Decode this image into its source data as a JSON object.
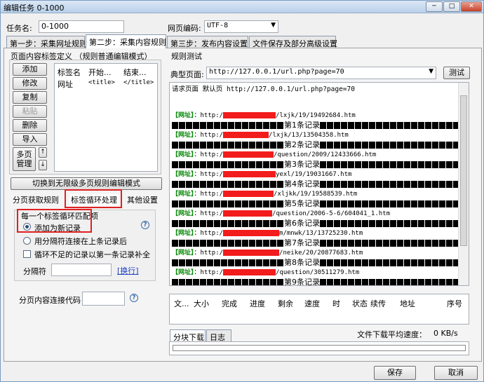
{
  "window": {
    "title": "编辑任务 0-1000",
    "min": "─",
    "max": "□",
    "close": "✕"
  },
  "task_name": {
    "label": "任务名:",
    "value": "0-1000"
  },
  "encoding": {
    "label": "网页编码:",
    "value": "UTF-8"
  },
  "tabs": [
    "第一步：采集网址规则",
    "第二步：采集内容规则",
    "第三步：发布内容设置",
    "文件保存及部分高级设置"
  ],
  "left": {
    "group_title": "页面内容标签定义 （规则普通编辑模式）",
    "buttons": [
      "添加",
      "修改",
      "复制",
      "粘贴",
      "删除",
      "导入",
      "多页\n管理"
    ],
    "up": "↑",
    "down": "↓",
    "table_headers": [
      "标签名",
      "开始...",
      "结束..."
    ],
    "table_rows": [
      {
        "name": "网址",
        "start": "<title>",
        "end": "</title>"
      }
    ],
    "switch_button": "切换到无限级多页规则编辑模式",
    "subtabs": [
      "分页获取规则",
      "标签循环处理",
      "其他设置"
    ],
    "loop_title": "每一个标签循环匹配项",
    "opt1": "添加为新记录",
    "opt2": "用分隔符连接在上条记录后",
    "opt3": "循环不足的记录以第一条记录补全",
    "sep_label": "分隔符",
    "newline_link": "[换行]",
    "paging_label": "分页内容连接代码",
    "help": "?"
  },
  "right": {
    "group_title": "规则测试",
    "typical_label": "典型页面:",
    "typical_url": "http://127.0.0.1/url.php?page=70",
    "test_button": "测试",
    "request_line": "请求页面 默认页 http://127.0.0.1/url.php?page=70",
    "results": [
      {
        "url_tail": "/lxjk/19/19492684.htm",
        "rec": "第1条记录"
      },
      {
        "url_tail": "/lxjk/13/13504358.htm",
        "rec": "第2条记录"
      },
      {
        "url_tail": "/question/2009/12433666.htm",
        "rec": "第3条记录"
      },
      {
        "url_tail": "yexl/19/19031667.htm",
        "rec": "第4条记录"
      },
      {
        "url_tail": "/xljkk/19/19588539.htm",
        "rec": "第5条记录"
      },
      {
        "url_tail": "/question/2006-5-6/604041_1.htm",
        "rec": "第6条记录"
      },
      {
        "url_tail": "m/mnwk/13/13725230.htm",
        "rec": "第7条记录"
      },
      {
        "url_tail": "/neike/20/20877683.htm",
        "rec": "第8条记录"
      },
      {
        "url_tail": "/question/30511279.htm",
        "rec": "第9条记录"
      }
    ],
    "url_label": "【网址】",
    "url_prefix": "：http:/",
    "dl_headers": [
      "文...",
      "大小",
      "完成",
      "进度",
      "剩余",
      "速度",
      "时",
      "状态",
      "续传",
      "地址",
      "序号"
    ],
    "bottom_tabs": [
      "分块下载",
      "日志"
    ],
    "avg_speed_label": "文件下载平均速度：",
    "avg_speed_value": "0 KB/s"
  },
  "footer": {
    "save": "保存",
    "cancel": "取消"
  },
  "colors": {
    "highlight": "#e02020",
    "green": "#0a8a0a"
  }
}
